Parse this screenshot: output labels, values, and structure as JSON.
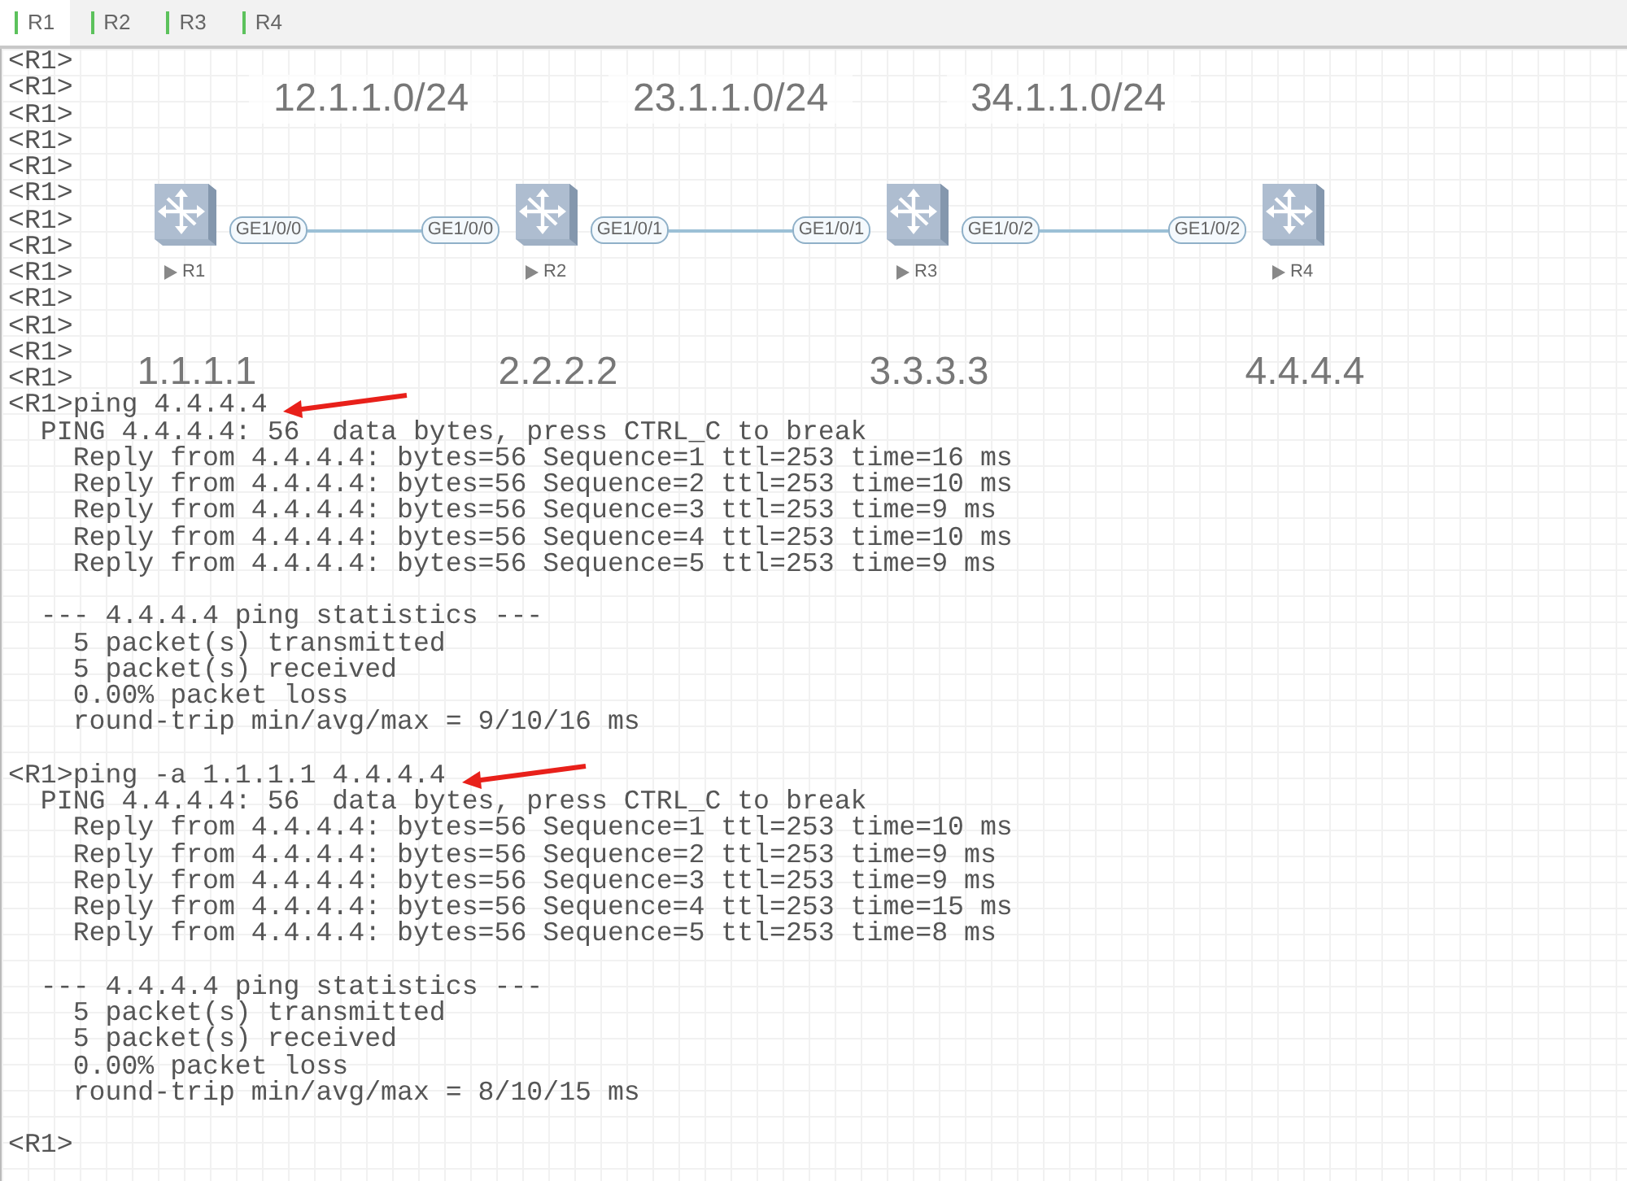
{
  "tabs": [
    {
      "label": "R1",
      "selected": true
    },
    {
      "label": "R2",
      "selected": false
    },
    {
      "label": "R3",
      "selected": false
    },
    {
      "label": "R4",
      "selected": false
    }
  ],
  "topology": {
    "routers": [
      {
        "name": "R1",
        "loopback": "1.1.1.1"
      },
      {
        "name": "R2",
        "loopback": "2.2.2.2"
      },
      {
        "name": "R3",
        "loopback": "3.3.3.3"
      },
      {
        "name": "R4",
        "loopback": "4.4.4.4"
      }
    ],
    "links": [
      {
        "subnet": "12.1.1.0/24",
        "left_port": "GE1/0/0",
        "right_port": "GE1/0/0"
      },
      {
        "subnet": "23.1.1.0/24",
        "left_port": "GE1/0/1",
        "right_port": "GE1/0/1"
      },
      {
        "subnet": "34.1.1.0/24",
        "left_port": "GE1/0/2",
        "right_port": "GE1/0/2"
      }
    ]
  },
  "terminal": {
    "blocks": [
      [
        "<R1>",
        "<R1>",
        "<R1>",
        "<R1>",
        "<R1>",
        "<R1>",
        "<R1>",
        "<R1>",
        "<R1>",
        "<R1>",
        "<R1>",
        "<R1>",
        "<R1>",
        {
          "text": "<R1>ping 4.4.4.4",
          "marked": true
        },
        "  PING 4.4.4.4: 56  data bytes, press CTRL_C to break",
        "    Reply from 4.4.4.4: bytes=56 Sequence=1 ttl=253 time=16 ms",
        "    Reply from 4.4.4.4: bytes=56 Sequence=2 ttl=253 time=10 ms",
        "    Reply from 4.4.4.4: bytes=56 Sequence=3 ttl=253 time=9 ms",
        "    Reply from 4.4.4.4: bytes=56 Sequence=4 ttl=253 time=10 ms",
        "    Reply from 4.4.4.4: bytes=56 Sequence=5 ttl=253 time=9 ms"
      ],
      [
        "  --- 4.4.4.4 ping statistics ---",
        "    5 packet(s) transmitted",
        "    5 packet(s) received",
        "    0.00% packet loss",
        "    round-trip min/avg/max = 9/10/16 ms"
      ],
      [
        {
          "text": "<R1>ping -a 1.1.1.1 4.4.4.4",
          "marked": true
        },
        "  PING 4.4.4.4: 56  data bytes, press CTRL_C to break",
        "    Reply from 4.4.4.4: bytes=56 Sequence=1 ttl=253 time=10 ms",
        "    Reply from 4.4.4.4: bytes=56 Sequence=2 ttl=253 time=9 ms",
        "    Reply from 4.4.4.4: bytes=56 Sequence=3 ttl=253 time=9 ms",
        "    Reply from 4.4.4.4: bytes=56 Sequence=4 ttl=253 time=15 ms",
        "    Reply from 4.4.4.4: bytes=56 Sequence=5 ttl=253 time=8 ms"
      ],
      [
        "  --- 4.4.4.4 ping statistics ---",
        "    5 packet(s) transmitted",
        "    5 packet(s) received",
        "    0.00% packet loss",
        "    round-trip min/avg/max = 8/10/15 ms"
      ],
      [
        "<R1>"
      ]
    ]
  }
}
